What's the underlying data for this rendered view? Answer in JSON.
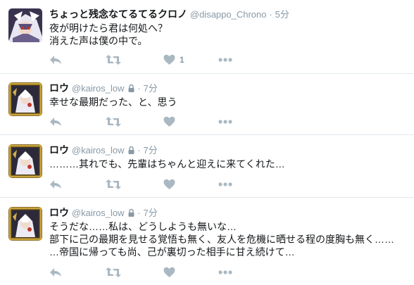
{
  "tweets": [
    {
      "name": "ちょっと残念なてるてるクロノ",
      "handle": "@disappo_Chrono",
      "time": "5分",
      "protected": false,
      "lines": [
        "夜が明けたら君は何処へ？",
        "消えた声は僕の中で。"
      ],
      "like_count": "1"
    },
    {
      "name": "ロウ",
      "handle": "@kairos_low",
      "time": "7分",
      "protected": true,
      "lines": [
        "幸せな最期だった、と、思う"
      ],
      "like_count": ""
    },
    {
      "name": "ロウ",
      "handle": "@kairos_low",
      "time": "7分",
      "protected": true,
      "lines": [
        "………其れでも、先輩はちゃんと迎えに来てくれた…"
      ],
      "like_count": ""
    },
    {
      "name": "ロウ",
      "handle": "@kairos_low",
      "time": "7分",
      "protected": true,
      "lines": [
        "そうだな……私は、どうしようも無いな…",
        "部下に己の最期を見せる覚悟も無く、友人を危機に晒せる程の度胸も無く……",
        "…帝国に帰っても尚、己が裏切った相手に甘え続けて…"
      ],
      "like_count": ""
    }
  ],
  "separator": "·",
  "icons": [
    "reply-icon",
    "retweet-icon",
    "like-icon",
    "more-icon",
    "lock-icon"
  ],
  "colors": {
    "icon": "#aab8c2",
    "meta": "#8899a6",
    "border": "#e1e8ed"
  }
}
